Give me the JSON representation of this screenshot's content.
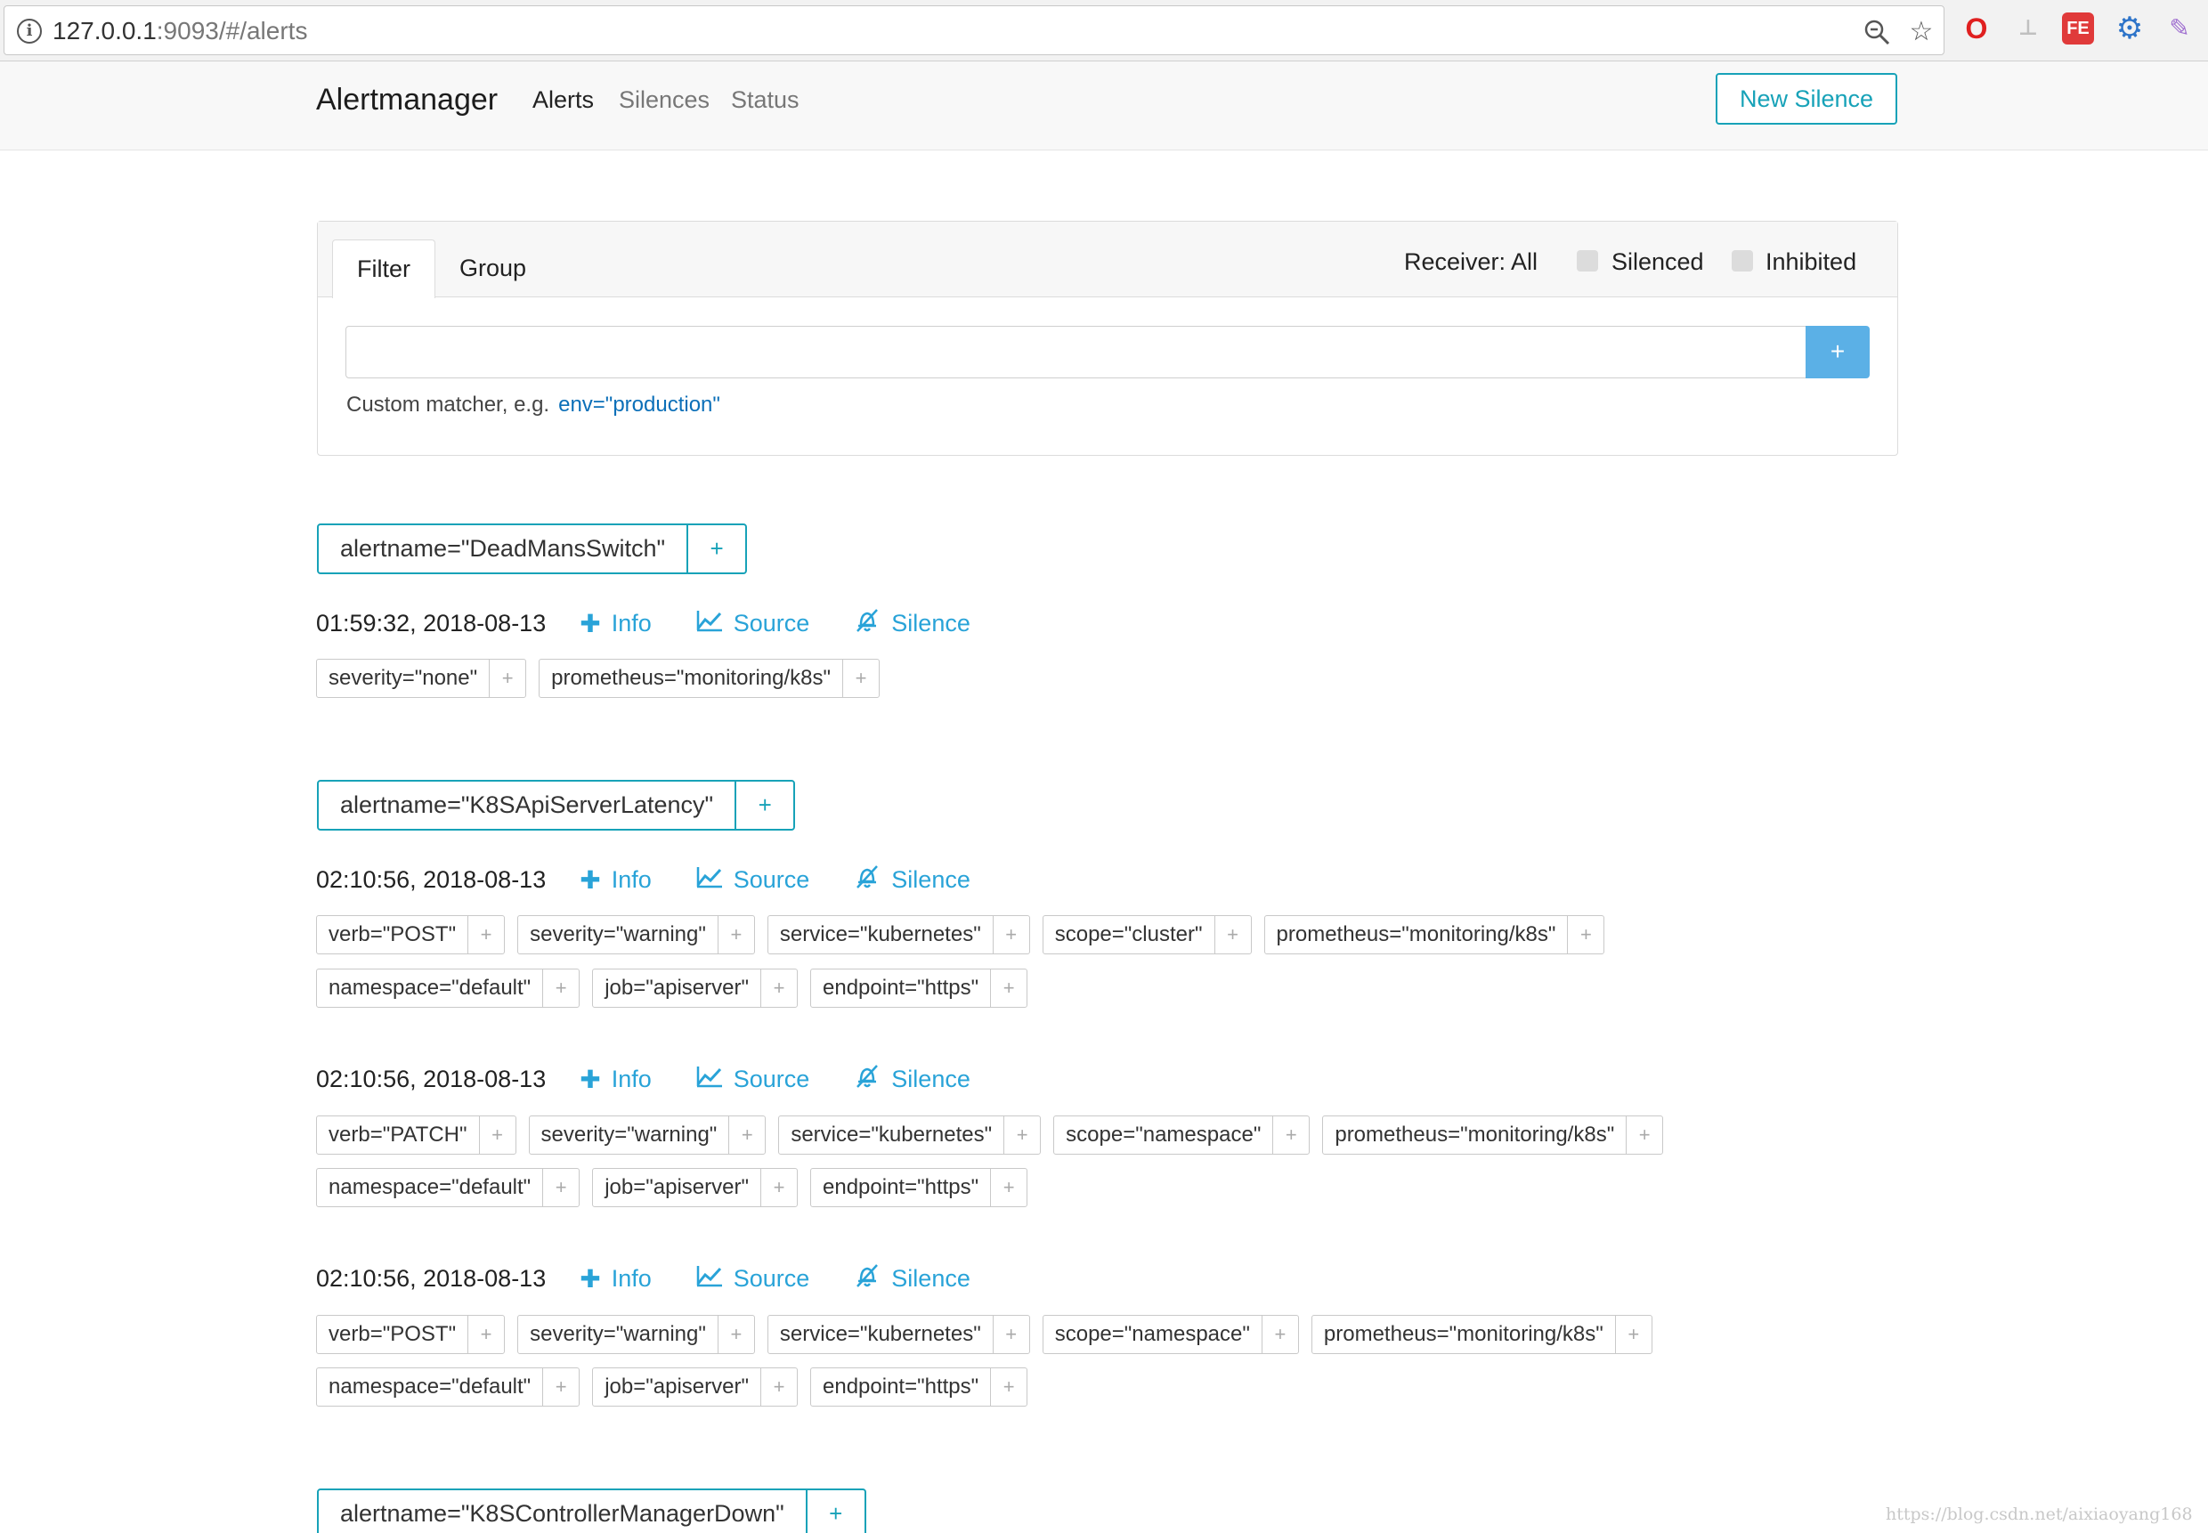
{
  "browser": {
    "url_host": "127.0.0.1",
    "url_rest": ":9093/#/alerts"
  },
  "navbar": {
    "brand": "Alertmanager",
    "links": [
      {
        "label": "Alerts",
        "active": true
      },
      {
        "label": "Silences",
        "active": false
      },
      {
        "label": "Status",
        "active": false
      }
    ],
    "new_silence_label": "New Silence"
  },
  "filter": {
    "tabs": [
      "Filter",
      "Group"
    ],
    "receiver_label": "Receiver: All",
    "silenced_label": "Silenced",
    "inhibited_label": "Inhibited",
    "plus_label": "+",
    "helper_text": "Custom matcher, e.g.",
    "helper_example": "env=\"production\""
  },
  "actions": {
    "info": "Info",
    "source": "Source",
    "silence": "Silence",
    "plus": "+"
  },
  "groups": [
    {
      "label": "alertname=\"DeadMansSwitch\"",
      "alerts": [
        {
          "time": "01:59:32, 2018-08-13",
          "labels": [
            [
              "severity=\"none\"",
              "prometheus=\"monitoring/k8s\""
            ]
          ]
        }
      ]
    },
    {
      "label": "alertname=\"K8SApiServerLatency\"",
      "alerts": [
        {
          "time": "02:10:56, 2018-08-13",
          "labels": [
            [
              "verb=\"POST\"",
              "severity=\"warning\"",
              "service=\"kubernetes\"",
              "scope=\"cluster\"",
              "prometheus=\"monitoring/k8s\""
            ],
            [
              "namespace=\"default\"",
              "job=\"apiserver\"",
              "endpoint=\"https\""
            ]
          ]
        },
        {
          "time": "02:10:56, 2018-08-13",
          "labels": [
            [
              "verb=\"PATCH\"",
              "severity=\"warning\"",
              "service=\"kubernetes\"",
              "scope=\"namespace\"",
              "prometheus=\"monitoring/k8s\""
            ],
            [
              "namespace=\"default\"",
              "job=\"apiserver\"",
              "endpoint=\"https\""
            ]
          ]
        },
        {
          "time": "02:10:56, 2018-08-13",
          "labels": [
            [
              "verb=\"POST\"",
              "severity=\"warning\"",
              "service=\"kubernetes\"",
              "scope=\"namespace\"",
              "prometheus=\"monitoring/k8s\""
            ],
            [
              "namespace=\"default\"",
              "job=\"apiserver\"",
              "endpoint=\"https\""
            ]
          ]
        }
      ]
    },
    {
      "label": "alertname=\"K8SControllerManagerDown\"",
      "alerts": []
    }
  ],
  "watermark": "https://blog.csdn.net/aixiaoyang168",
  "colors": {
    "accent": "#17a2b8",
    "link": "#29a3d8",
    "primary_button": "#5bb0e6"
  }
}
